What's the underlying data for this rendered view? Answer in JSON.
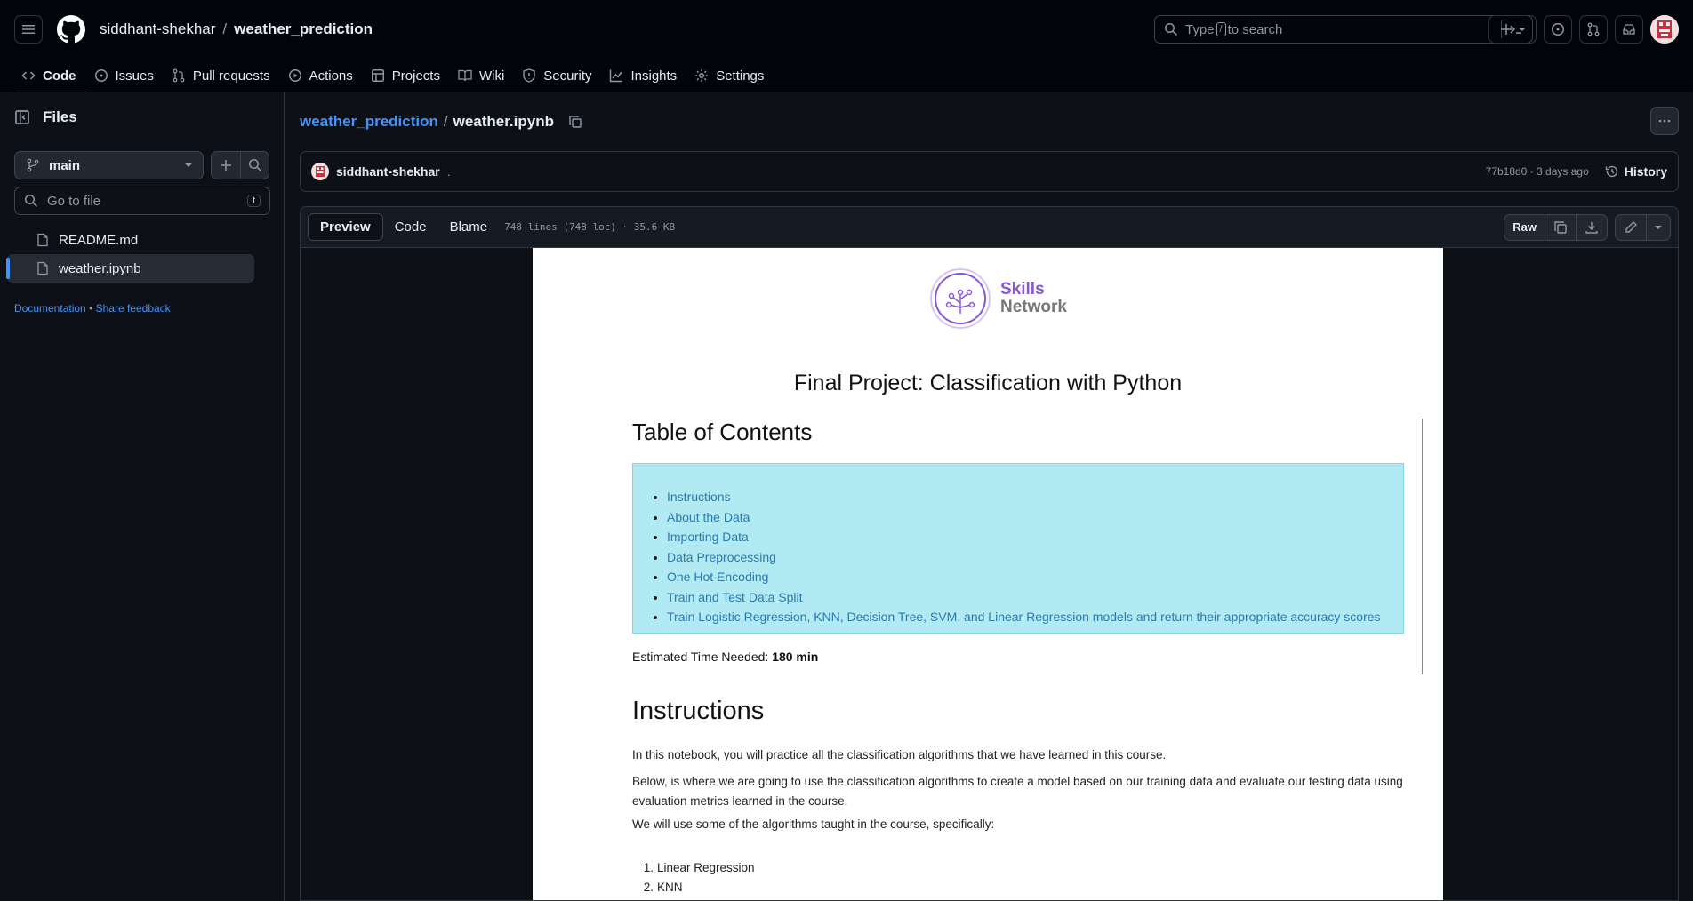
{
  "header": {
    "owner": "siddhant-shekhar",
    "separator": "/",
    "repo": "weather_prediction",
    "search_prefix": "Type",
    "search_key": "/",
    "search_suffix": "to search"
  },
  "nav": {
    "tabs": [
      {
        "label": "Code",
        "icon": "code-icon"
      },
      {
        "label": "Issues",
        "icon": "issue-icon"
      },
      {
        "label": "Pull requests",
        "icon": "pull-request-icon"
      },
      {
        "label": "Actions",
        "icon": "play-icon"
      },
      {
        "label": "Projects",
        "icon": "table-icon"
      },
      {
        "label": "Wiki",
        "icon": "book-icon"
      },
      {
        "label": "Security",
        "icon": "shield-icon"
      },
      {
        "label": "Insights",
        "icon": "graph-icon"
      },
      {
        "label": "Settings",
        "icon": "gear-icon"
      }
    ]
  },
  "sidebar": {
    "title": "Files",
    "branch": "main",
    "goto_placeholder": "Go to file",
    "goto_key": "t",
    "files": [
      "README.md",
      "weather.ipynb"
    ],
    "doc_link": "Documentation",
    "dot": "•",
    "feedback_link": "Share feedback"
  },
  "file": {
    "repo_link": "weather_prediction",
    "sep": "/",
    "name": "weather.ipynb",
    "author": "siddhant-shekhar",
    "author_suffix": ".",
    "commit": "77b18d0",
    "commit_sep": "·",
    "age": "3 days ago",
    "history": "History"
  },
  "viewer": {
    "tabs": [
      "Preview",
      "Code",
      "Blame"
    ],
    "info": "748 lines (748 loc) · 35.6 KB",
    "raw": "Raw"
  },
  "notebook": {
    "logo_line1": "Skills",
    "logo_line2": "Network",
    "title": "Final Project: Classification with Python",
    "toc_heading": "Table of Contents",
    "toc": [
      "Instructions",
      "About the Data",
      "Importing Data",
      "Data Preprocessing",
      "One Hot Encoding",
      "Train and Test Data Split",
      "Train Logistic Regression, KNN, Decision Tree, SVM, and Linear Regression models and return their appropriate accuracy scores"
    ],
    "est_label": "Estimated Time Needed:",
    "est_value": "180 min",
    "instructions_heading": "Instructions",
    "p1": "In this notebook, you will practice all the classification algorithms that we have learned in this course.",
    "p2": "Below, is where we are going to use the classification algorithms to create a model based on our training data and evaluate our testing data using evaluation metrics learned in the course.",
    "p3": "We will use some of the algorithms taught in the course, specifically:",
    "algos": [
      "Linear Regression",
      "KNN"
    ]
  },
  "colors": {
    "accent": "#f78166",
    "link": "#4493f8",
    "toc_bg": "#b1eaf2"
  }
}
